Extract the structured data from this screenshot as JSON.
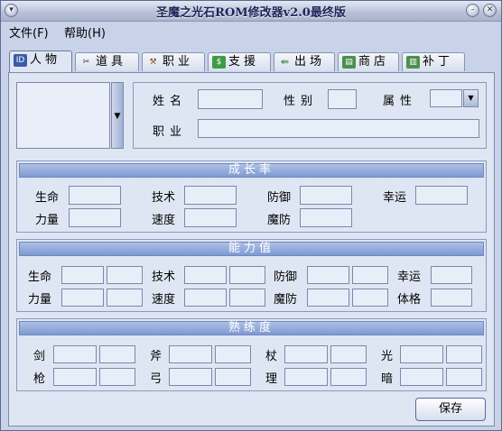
{
  "window": {
    "title": "圣魔之光石ROM修改器v2.0最终版"
  },
  "menu": {
    "file": "文件(F)",
    "help": "帮助(H)"
  },
  "tabs": [
    {
      "label": "人物",
      "icon": "id-card-icon",
      "icon_text": "ID"
    },
    {
      "label": "道具",
      "icon": "scissors-icon"
    },
    {
      "label": "职业",
      "icon": "axe-icon"
    },
    {
      "label": "支援",
      "icon": "money-icon"
    },
    {
      "label": "出场",
      "icon": "arrows-icon"
    },
    {
      "label": "商店",
      "icon": "shop-icon"
    },
    {
      "label": "补丁",
      "icon": "patch-icon"
    }
  ],
  "profile": {
    "name": "姓名",
    "gender": "性别",
    "attribute": "属性",
    "class": "职业"
  },
  "growth": {
    "header": "成长率",
    "labels": [
      "生命",
      "技术",
      "防御",
      "幸运",
      "力量",
      "速度",
      "魔防"
    ]
  },
  "ability": {
    "header": "能力值",
    "labels": [
      "生命",
      "技术",
      "防御",
      "幸运",
      "力量",
      "速度",
      "魔防",
      "体格"
    ]
  },
  "proficiency": {
    "header": "熟练度",
    "labels": [
      "剑",
      "斧",
      "杖",
      "光",
      "枪",
      "弓",
      "理",
      "暗"
    ]
  },
  "save_button": "保存",
  "colors": {
    "panel": "#dfe6f3",
    "header": "#7f9ad2",
    "window": "#c8d3e9"
  }
}
